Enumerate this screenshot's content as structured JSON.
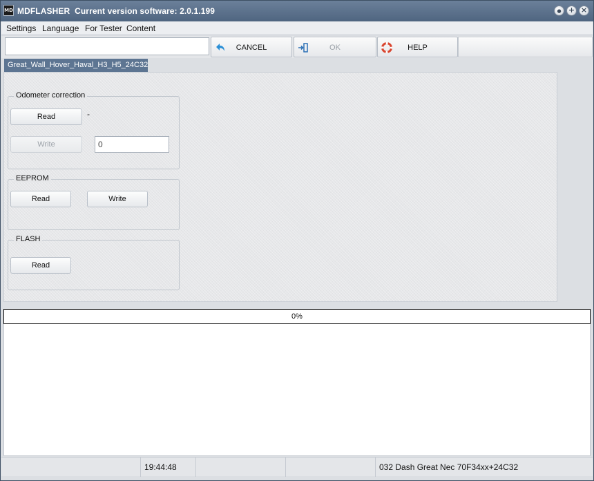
{
  "window": {
    "app_name": "MDFLASHER",
    "version_text": "Current version software: 2.0.1.199",
    "icon_text": "MD",
    "controls": {
      "minimize": "●",
      "maximize": "+",
      "close": "×"
    }
  },
  "menu": {
    "items": [
      {
        "label": "Settings"
      },
      {
        "label": "Language"
      },
      {
        "label": "For Tester"
      },
      {
        "label": "Content"
      }
    ]
  },
  "toolbar": {
    "input_value": "",
    "cancel_label": "CANCEL",
    "ok_label": "OK",
    "help_label": "HELP",
    "icons": {
      "cancel": "undo-arrow-icon",
      "ok": "exit-door-icon",
      "help": "lifebuoy-icon"
    }
  },
  "tab": {
    "label": "Great_Wall_Hover_Haval_H3_H5_24C32"
  },
  "odometer": {
    "title": "Odometer correction",
    "read_label": "Read",
    "value_text": "-",
    "write_label": "Write",
    "input_value": "0"
  },
  "eeprom": {
    "title": "EEPROM",
    "read_label": "Read",
    "write_label": "Write"
  },
  "flash": {
    "title": "FLASH",
    "read_label": "Read"
  },
  "progress": {
    "value": 0,
    "text": "0%"
  },
  "log": {
    "text": ""
  },
  "status": {
    "cells": [
      "",
      "19:44:48",
      "",
      "",
      "032 Dash Great Nec 70F34xx+24C32"
    ]
  },
  "colors": {
    "titlebar": "#5d7592",
    "tab_active": "#5d7592",
    "help_icon": "#d9452f",
    "cancel_icon": "#2a8fd6",
    "ok_icon": "#2a6fb5"
  }
}
